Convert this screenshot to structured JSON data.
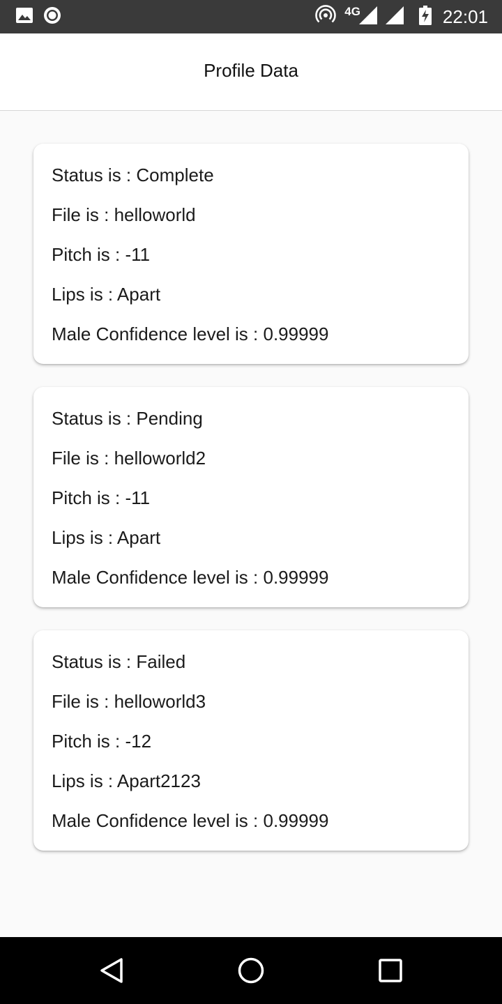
{
  "status_bar": {
    "left_icons": [
      "image-icon",
      "record-icon"
    ],
    "network": "4G",
    "time": "22:01"
  },
  "header": {
    "title": "Profile Data"
  },
  "records": [
    {
      "status": "Status is : Complete",
      "file": "File is : helloworld",
      "pitch": "Pitch is : -11",
      "lips": "Lips is : Apart",
      "confidence": "Male Confidence level is : 0.99999"
    },
    {
      "status": "Status is : Pending",
      "file": "File is : helloworld2",
      "pitch": "Pitch is : -11",
      "lips": "Lips is : Apart",
      "confidence": "Male Confidence level is : 0.99999"
    },
    {
      "status": "Status is : Failed",
      "file": "File is : helloworld3",
      "pitch": "Pitch is : -12",
      "lips": "Lips is : Apart2123",
      "confidence": "Male Confidence level is : 0.99999"
    }
  ],
  "nav_bar": {
    "icons": [
      "back-icon",
      "home-icon",
      "recents-icon"
    ]
  }
}
